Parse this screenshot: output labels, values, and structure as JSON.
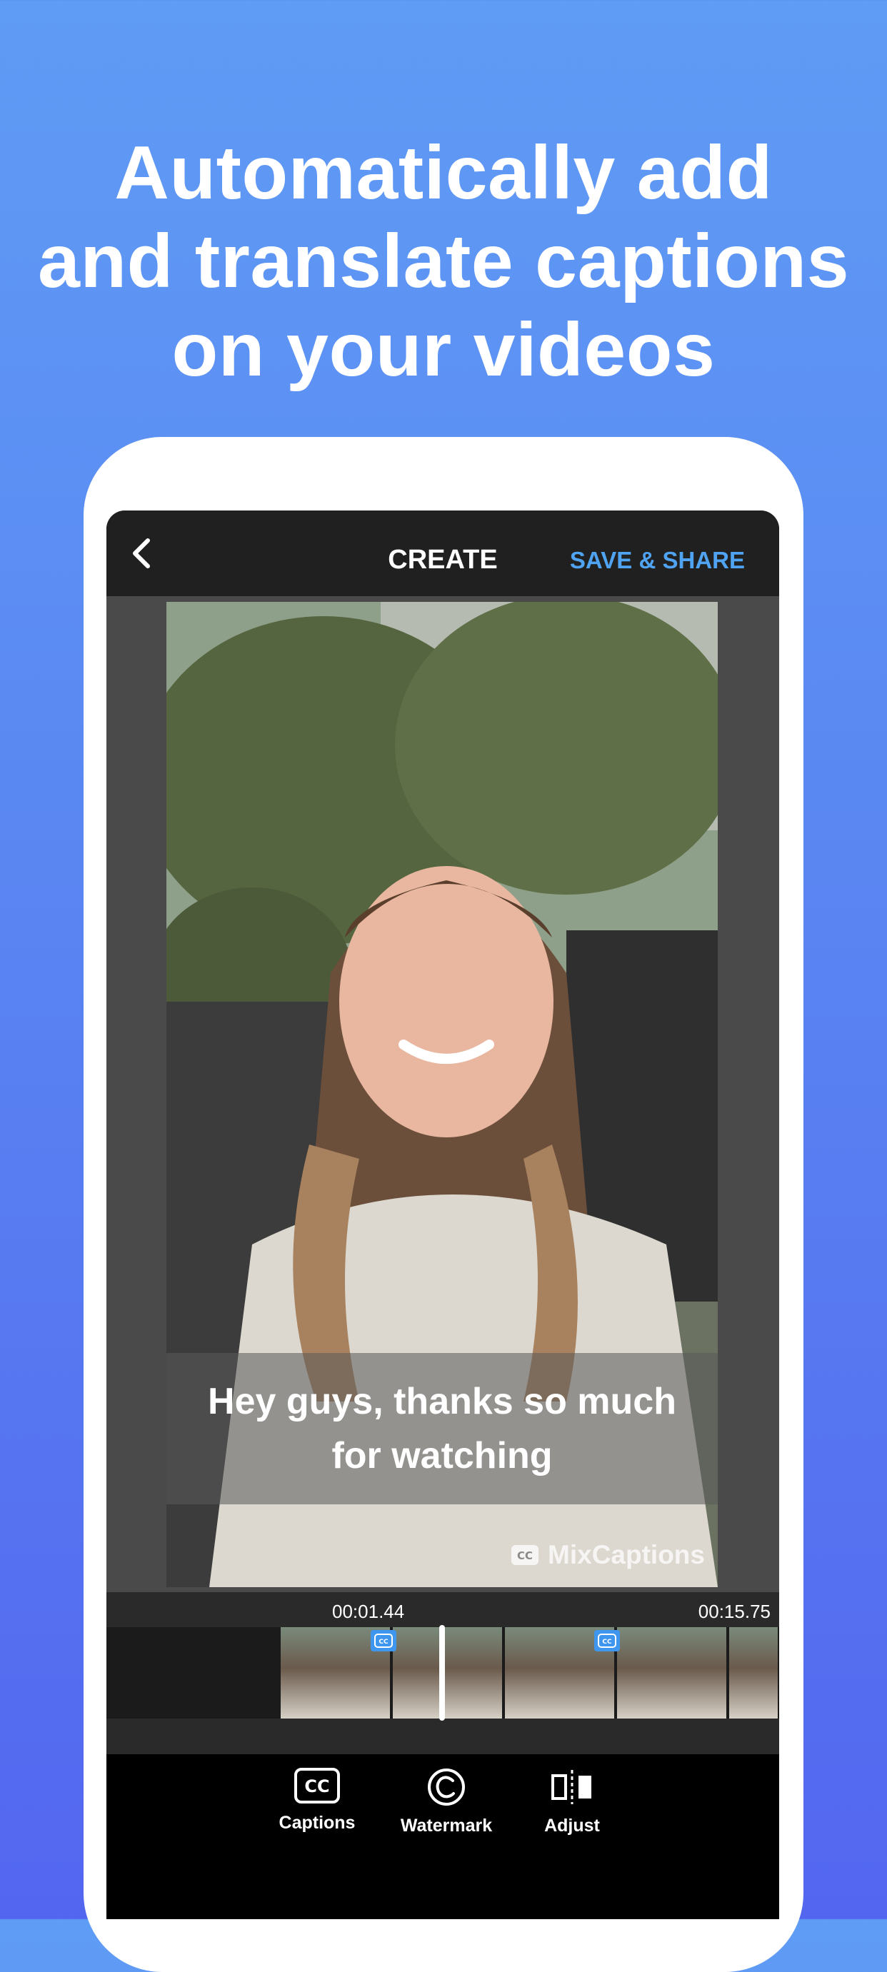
{
  "headline": {
    "line1": "Automatically add",
    "line2": "and translate captions",
    "line3": "on your videos"
  },
  "app": {
    "title": "CREATE",
    "save_label": "SAVE & SHARE"
  },
  "video": {
    "caption": "Hey guys, thanks so much for watching",
    "watermark": "MixCaptions"
  },
  "timeline": {
    "current_time": "00:01.44",
    "total_time": "00:15.75"
  },
  "toolbar": {
    "items": [
      {
        "label": "Captions",
        "icon": "cc-icon"
      },
      {
        "label": "Watermark",
        "icon": "copyright-icon"
      },
      {
        "label": "Adjust",
        "icon": "adjust-icon"
      }
    ]
  },
  "colors": {
    "accent": "#4fa3f0",
    "cc_marker": "#3e96ee",
    "background_top": "#5f9cf5",
    "background_bottom": "#5366f0"
  }
}
